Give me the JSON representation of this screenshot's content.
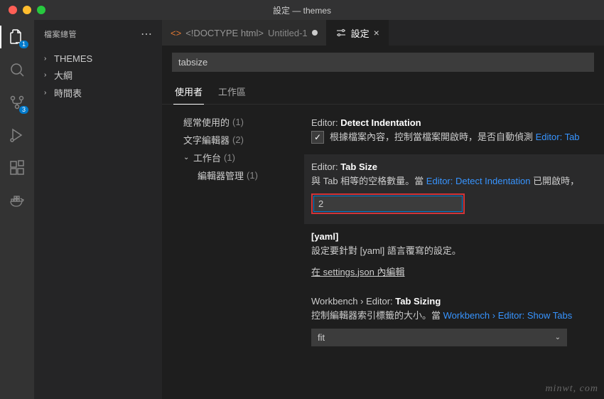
{
  "window": {
    "title": "設定 — themes"
  },
  "activitybar": {
    "explorer_badge": "1",
    "scm_badge": "3"
  },
  "sidebar": {
    "title": "檔案總管",
    "sections": [
      {
        "label": "THEMES"
      },
      {
        "label": "大綱"
      },
      {
        "label": "時間表"
      }
    ]
  },
  "tabs": {
    "file": {
      "icon_label": "<>",
      "label": "<!DOCTYPE html>",
      "sublabel": "Untitled-1"
    },
    "settings": {
      "label": "設定"
    }
  },
  "search": {
    "value": "tabsize"
  },
  "settings_tabs": {
    "user": "使用者",
    "workspace": "工作區"
  },
  "toc": {
    "common": {
      "label": "經常使用的",
      "count": "(1)"
    },
    "textEditor": {
      "label": "文字編輯器",
      "count": "(2)"
    },
    "workbench": {
      "label": "工作台",
      "count": "(1)"
    },
    "editorMgmt": {
      "label": "編輯器管理",
      "count": "(1)"
    }
  },
  "settings": {
    "detectIndent": {
      "group": "Editor:",
      "name": "Detect Indentation",
      "desc_pre": "根據檔案內容，控制當檔案開啟時，是否自動偵測 ",
      "desc_link": "Editor: Tab"
    },
    "tabSize": {
      "group": "Editor:",
      "name": "Tab Size",
      "desc_pre": "與 Tab 相等的空格數量。當 ",
      "desc_link": "Editor: Detect Indentation",
      "desc_post": " 已開啟時，",
      "value": "2"
    },
    "yaml": {
      "name": "[yaml]",
      "desc": "設定要針對 [yaml] 語言覆寫的設定。",
      "edit_link": "在 settings.json 內編輯"
    },
    "tabSizing": {
      "group": "Workbench › Editor:",
      "name": "Tab Sizing",
      "desc_pre": "控制編輯器索引標籤的大小。當 ",
      "desc_link": "Workbench › Editor: Show Tabs",
      "value": "fit"
    }
  },
  "watermark": "minwt, com"
}
